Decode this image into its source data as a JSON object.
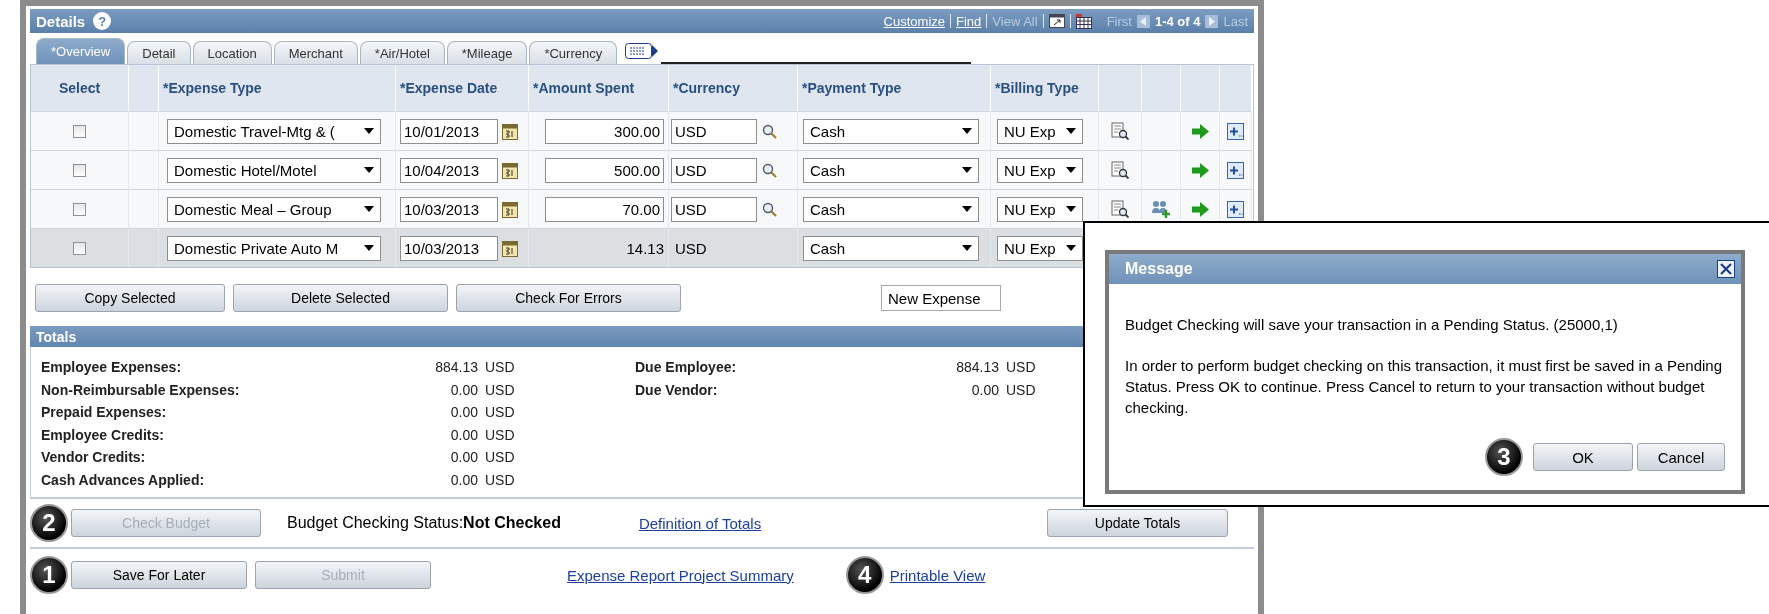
{
  "header": {
    "title": "Details",
    "help": "?",
    "links": [
      {
        "label": "Customize",
        "disabled": false
      },
      {
        "label": "Find",
        "disabled": false
      },
      {
        "label": "View All",
        "disabled": true
      }
    ],
    "nav": {
      "first": "First",
      "range": "1-4 of 4",
      "last": "Last"
    }
  },
  "tabs": [
    {
      "label": "*Overview",
      "selected": true
    },
    {
      "label": "Detail",
      "selected": false
    },
    {
      "label": "Location",
      "selected": false
    },
    {
      "label": "Merchant",
      "selected": false
    },
    {
      "label": "*Air/Hotel",
      "selected": false
    },
    {
      "label": "*Mileage",
      "selected": false
    },
    {
      "label": "*Currency",
      "selected": false
    }
  ],
  "table": {
    "columns": [
      "Select",
      "*Expense Type",
      "*Expense Date",
      "*Amount Spent",
      "*Currency",
      "*Payment Type",
      "*Billing Type"
    ],
    "rows": [
      {
        "checked": false,
        "highlighted": false,
        "expense_type": "Domestic Travel-Mtg & (",
        "date": "10/01/2013",
        "amount": {
          "kind": "input",
          "text": "300.00"
        },
        "currency": "USD",
        "payment_type": "Cash",
        "billing_type": "NU Exp",
        "icons": [
          {
            "kind": "detail"
          },
          {
            "kind": "next"
          },
          {
            "kind": "add"
          }
        ]
      },
      {
        "checked": false,
        "highlighted": false,
        "expense_type": "Domestic Hotel/Motel",
        "date": "10/04/2013",
        "amount": {
          "kind": "input",
          "text": "500.00"
        },
        "currency": "USD",
        "payment_type": "Cash",
        "billing_type": "NU Exp",
        "icons": [
          {
            "kind": "detail"
          },
          {
            "kind": "next"
          },
          {
            "kind": "add"
          }
        ]
      },
      {
        "checked": false,
        "highlighted": false,
        "expense_type": "Domestic Meal – Group",
        "date": "10/03/2013",
        "amount": {
          "kind": "input",
          "text": "70.00"
        },
        "currency": "USD",
        "payment_type": "Cash",
        "billing_type": "NU Exp",
        "icons": [
          {
            "kind": "detail"
          },
          {
            "kind": "attendees"
          },
          {
            "kind": "next"
          },
          {
            "kind": "add"
          }
        ]
      },
      {
        "checked": false,
        "highlighted": true,
        "expense_type": "Domestic Private Auto M",
        "date": "10/03/2013",
        "amount": {
          "kind": "text",
          "text": "14.13"
        },
        "currency": "USD",
        "payment_type": "Cash",
        "billing_type": "NU Exp",
        "icons": []
      }
    ]
  },
  "actions": {
    "buttons": [
      {
        "label": "Copy Selected",
        "disabled": false
      },
      {
        "label": "Delete Selected",
        "disabled": false
      },
      {
        "label": "Check For Errors",
        "disabled": false
      }
    ],
    "add_dropdown": "New Expense"
  },
  "totals": {
    "title": "Totals",
    "left": [
      {
        "label": "Employee Expenses:",
        "value": "884.13",
        "currency": "USD"
      },
      {
        "label": "Non-Reimbursable Expenses:",
        "value": "0.00",
        "currency": "USD"
      },
      {
        "label": "Prepaid Expenses:",
        "value": "0.00",
        "currency": "USD"
      },
      {
        "label": "Employee Credits:",
        "value": "0.00",
        "currency": "USD"
      },
      {
        "label": "Vendor Credits:",
        "value": "0.00",
        "currency": "USD"
      },
      {
        "label": "Cash Advances Applied:",
        "value": "0.00",
        "currency": "USD"
      }
    ],
    "right": [
      {
        "label": "Due Employee:",
        "value": "884.13",
        "currency": "USD"
      },
      {
        "label": "Due Vendor:",
        "value": "0.00",
        "currency": "USD"
      }
    ]
  },
  "budget": {
    "button": {
      "label": "Check Budget",
      "disabled": true,
      "marker": "2"
    },
    "status_label": "Budget Checking Status:",
    "status_value": "Not Checked",
    "link": "Definition of Totals",
    "update_button": {
      "label": "Update Totals",
      "disabled": false
    }
  },
  "footer": {
    "buttons": [
      {
        "label": "Save For Later",
        "disabled": false,
        "marker": "1"
      },
      {
        "label": "Submit",
        "disabled": true
      }
    ],
    "links": [
      {
        "label": "Expense Report Project Summary"
      },
      {
        "label": "Printable View",
        "marker": "4"
      }
    ]
  },
  "dialog": {
    "title": "Message",
    "paragraphs": [
      "Budget Checking will save your transaction in a Pending Status. (25000,1)",
      "In order to perform budget checking on this transaction, it must first be saved in a Pending Status.  Press OK to continue.  Press Cancel to return to your transaction without budget checking."
    ],
    "buttons": [
      {
        "label": "OK",
        "marker": "3"
      },
      {
        "label": "Cancel"
      }
    ]
  }
}
